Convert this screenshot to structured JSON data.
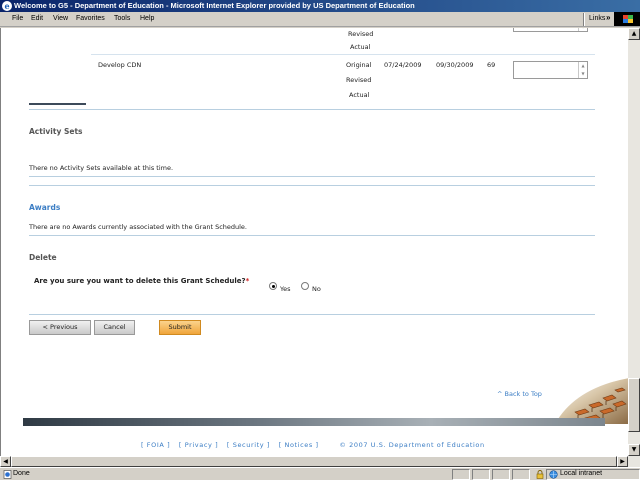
{
  "window": {
    "title": "Welcome to G5 - Department of Education - Microsoft Internet Explorer provided by US Department of Education"
  },
  "menubar": {
    "items": [
      "File",
      "Edit",
      "View",
      "Favorites",
      "Tools",
      "Help"
    ],
    "links_label": "Links",
    "chevron": "»"
  },
  "schedule_table": {
    "top_row": {
      "lines": [
        "Revised",
        "Actual"
      ]
    },
    "row": {
      "activity": "Develop CDN",
      "lines": [
        "Original",
        "Revised",
        "Actual"
      ],
      "start_date": "07/24/2009",
      "end_date": "09/30/2009",
      "days": "69"
    }
  },
  "activity_sets": {
    "title": "Activity Sets",
    "message": "There no Activity Sets available at this time."
  },
  "awards": {
    "title": "Awards",
    "message": "There are no Awards currently associated with the Grant Schedule."
  },
  "delete": {
    "title": "Delete",
    "question": "Are you sure you want to delete this Grant Schedule?",
    "required_mark": "*",
    "options": [
      {
        "label": "Yes",
        "selected": true
      },
      {
        "label": "No",
        "selected": false
      }
    ]
  },
  "buttons": {
    "previous": "< Previous",
    "cancel": "Cancel",
    "submit": "Submit"
  },
  "back_to_top": "^ Back to Top",
  "footer": {
    "links": [
      "[ FOIA ]",
      "[ Privacy ]",
      "[ Security ]",
      "[ Notices ]"
    ],
    "copyright": "© 2007 U.S. Department of Education"
  },
  "statusbar": {
    "status": "Done",
    "zone": "Local intranet"
  },
  "colors": {
    "title_bar": "#0a246a",
    "section_blue": "#3b7dc4",
    "submit_orange": "#f0a53b",
    "rule_blue": "#b8cfe0"
  }
}
